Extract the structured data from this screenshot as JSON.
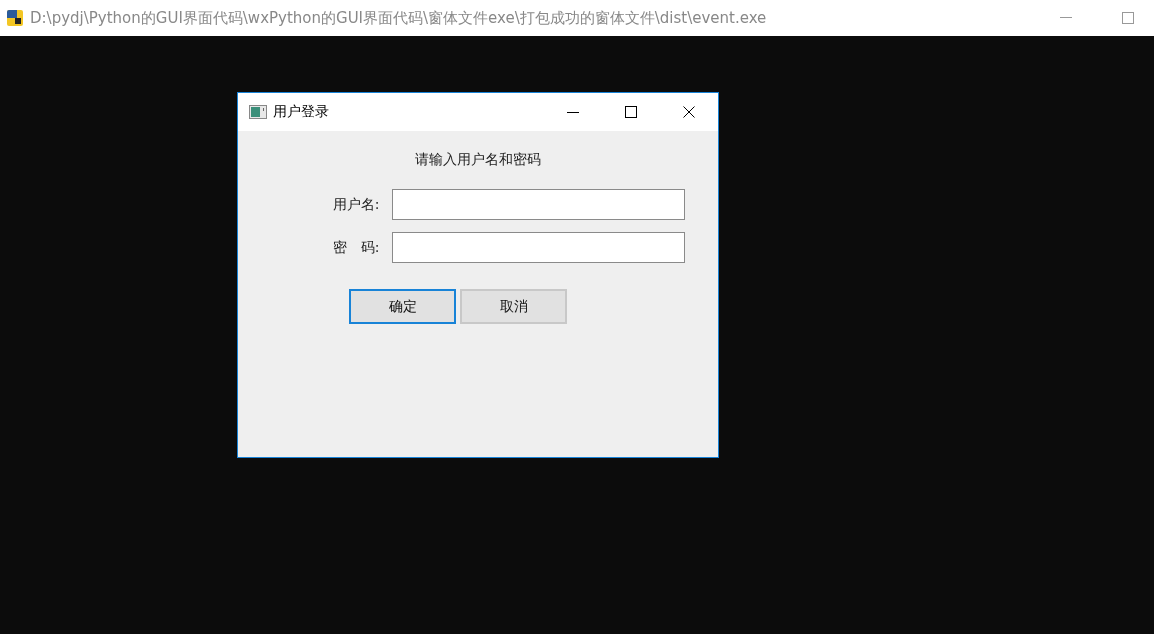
{
  "window": {
    "title": "D:\\pydj\\Python的GUI界面代码\\wxPython的GUI界面代码\\窗体文件exe\\打包成功的窗体文件\\dist\\event.exe"
  },
  "dialog": {
    "title": "用户登录",
    "prompt": "请输入用户名和密码",
    "fields": [
      {
        "label": "用户名:"
      },
      {
        "label": "密　码:"
      }
    ],
    "buttons": [
      {
        "label": "确定",
        "focused": true
      },
      {
        "label": "取消",
        "focused": false
      }
    ]
  }
}
